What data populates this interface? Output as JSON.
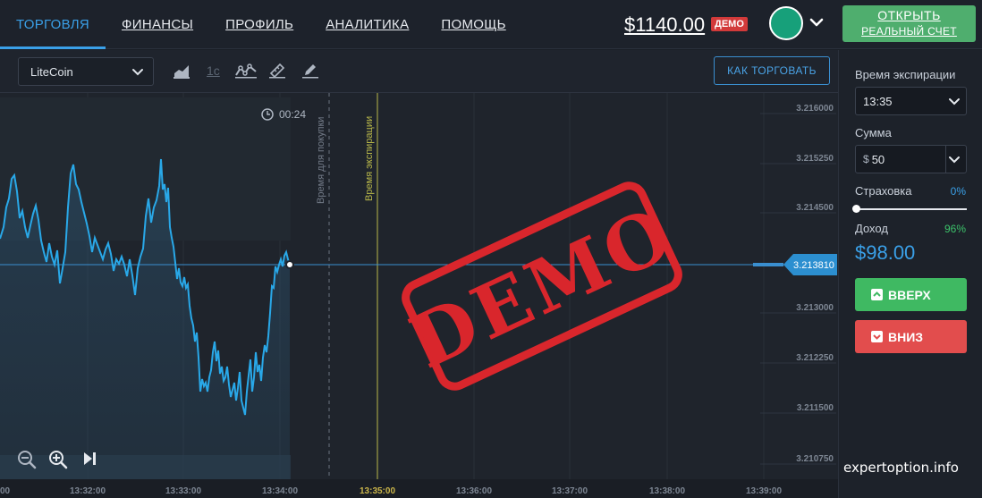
{
  "nav": {
    "items": [
      {
        "label": "ТОРГОВЛЯ",
        "active": true
      },
      {
        "label": "ФИНАНСЫ",
        "active": false
      },
      {
        "label": "ПРОФИЛЬ",
        "active": false
      },
      {
        "label": "АНАЛИТИКА",
        "active": false
      },
      {
        "label": "ПОМОЩЬ",
        "active": false
      }
    ]
  },
  "account": {
    "balance": "$1140.00",
    "mode_badge": "ДЕМО",
    "open_real_line1": "ОТКРЫТЬ",
    "open_real_line2": "РЕАЛЬНЫЙ СЧЕТ"
  },
  "toolbar": {
    "asset": "LiteCoin",
    "timeframe": "1c",
    "how_to_trade": "КАК ТОРГОВАТЬ"
  },
  "chart": {
    "timer": "00:24",
    "purchase_line_label": "Время для покупки",
    "expiry_line_label": "Время экспирации",
    "current_price": "3.213810",
    "stamp_text": "DEMO",
    "y_ticks": [
      "3.216000",
      "3.215250",
      "3.214500",
      "3.213000",
      "3.212250",
      "3.211500",
      "3.210750"
    ],
    "x_ticks": [
      {
        "label": "13:32:00",
        "highlight": false
      },
      {
        "label": "13:33:00",
        "highlight": false
      },
      {
        "label": "13:34:00",
        "highlight": false
      },
      {
        "label": "13:35:00",
        "highlight": true
      },
      {
        "label": "13:36:00",
        "highlight": false
      },
      {
        "label": "13:37:00",
        "highlight": false
      },
      {
        "label": "13:38:00",
        "highlight": false
      },
      {
        "label": "13:39:00",
        "highlight": false
      }
    ],
    "edge_label": "00",
    "colors": {
      "line": "#29a8e8",
      "expiry": "#b9b84a",
      "stamp": "#d9262c"
    }
  },
  "panel": {
    "expiry_label": "Время экспирации",
    "expiry_value": "13:35",
    "amount_label": "Сумма",
    "amount_currency": "$",
    "amount_value": "50",
    "insurance_label": "Страховка",
    "insurance_value": "0%",
    "income_label": "Доход",
    "income_pct": "96%",
    "payout": "$98.00",
    "up_label": "ВВЕРХ",
    "down_label": "ВНИЗ"
  },
  "watermark": "expertoption.info"
}
